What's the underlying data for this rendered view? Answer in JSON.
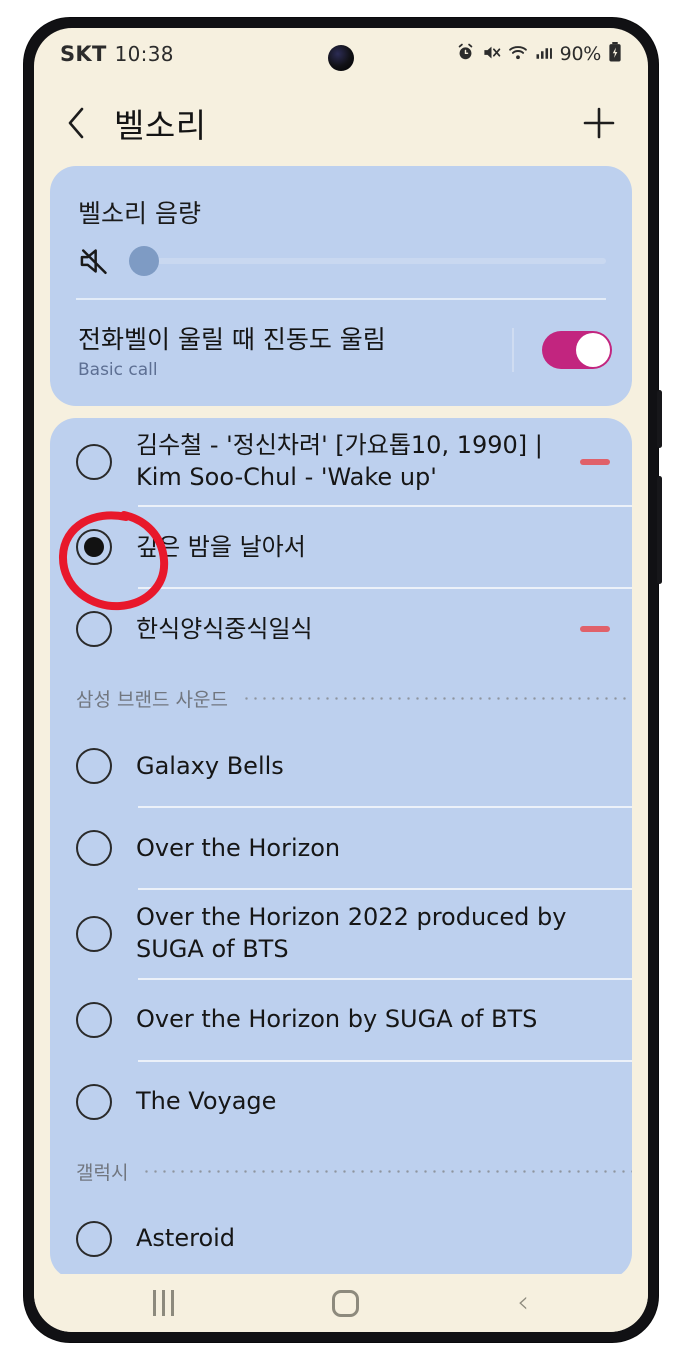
{
  "status_bar": {
    "carrier": "SKT",
    "time": "10:38",
    "icons": [
      "alarm-icon",
      "mute-icon",
      "wifi-icon",
      "signal-icon"
    ],
    "battery_percent": "90%",
    "battery_icon": "battery-charging-icon"
  },
  "app_bar": {
    "back_icon": "chevron-left-icon",
    "title": "벨소리",
    "add_icon": "plus-icon"
  },
  "volume_card": {
    "label": "벨소리 음량",
    "mute_icon": "speaker-mute-icon",
    "slider_value": 3,
    "slider_min": 0,
    "slider_max": 100
  },
  "vibrate_row": {
    "title": "전화벨이 울릴 때 진동도 울림",
    "subtitle": "Basic call",
    "toggle_on": true,
    "toggle_color": "#c2257f"
  },
  "ringtones": [
    {
      "label": "김수철 - '정신차려' [가요톱10, 1990] | Kim Soo-Chul - 'Wake up'",
      "selected": false,
      "deletable": true
    },
    {
      "label": "깊은 밤을 날아서",
      "selected": true,
      "deletable": false
    },
    {
      "label": "한식양식중식일식",
      "selected": false,
      "deletable": true
    }
  ],
  "sections": [
    {
      "title": "삼성 브랜드 사운드",
      "items": [
        {
          "label": "Galaxy Bells",
          "selected": false
        },
        {
          "label": "Over the Horizon",
          "selected": false
        },
        {
          "label": "Over the Horizon 2022 produced by SUGA of BTS",
          "selected": false
        },
        {
          "label": "Over the Horizon by SUGA of BTS",
          "selected": false
        },
        {
          "label": "The Voyage",
          "selected": false
        }
      ]
    },
    {
      "title": "갤럭시",
      "items": [
        {
          "label": "Asteroid",
          "selected": false
        }
      ]
    }
  ],
  "annotation": {
    "type": "hand-drawn-circle",
    "color": "#e8182b",
    "target": "selected-radio-button"
  },
  "nav_bar": {
    "recents_icon": "recents-icon",
    "home_icon": "home-icon",
    "back_icon": "back-icon",
    "back_glyph": "‹"
  },
  "colors": {
    "screen_bg": "#f6f0df",
    "card_bg": "#bdd0ee",
    "accent_pink": "#c2257f",
    "delete_red": "#e0616a",
    "annotation_red": "#e8182b"
  }
}
